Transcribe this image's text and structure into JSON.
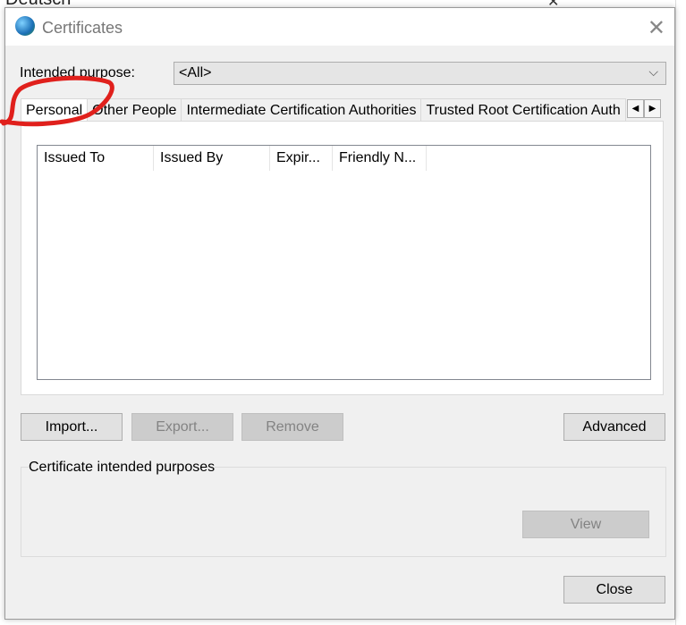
{
  "background": {
    "text": "Deutsch"
  },
  "dialog": {
    "title": "Certificates",
    "intended_purpose_label": "Intended purpose:",
    "intended_purpose_value": "<All>",
    "tabs": [
      {
        "label": "Personal",
        "active": true
      },
      {
        "label": "Other People"
      },
      {
        "label": "Intermediate Certification Authorities"
      },
      {
        "label": "Trusted Root Certification Auth"
      }
    ],
    "columns": [
      "Issued To",
      "Issued By",
      "Expir...",
      "Friendly N..."
    ],
    "buttons": {
      "import": "Import...",
      "export": "Export...",
      "remove": "Remove",
      "advanced": "Advanced",
      "view": "View",
      "close": "Close"
    },
    "group_label": "Certificate intended purposes"
  },
  "annotation_color": "#e0201c"
}
